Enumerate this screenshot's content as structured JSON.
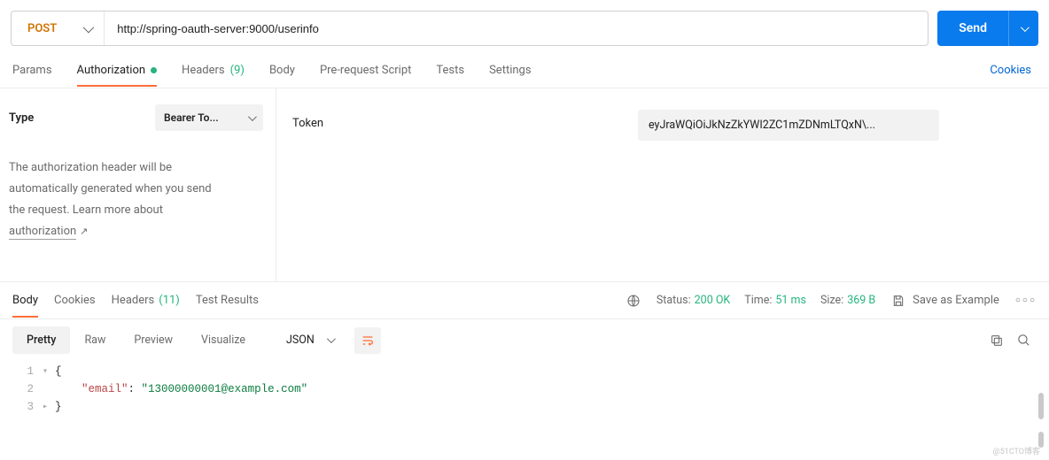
{
  "request": {
    "method": "POST",
    "url": "http://spring-oauth-server:9000/userinfo",
    "send_label": "Send"
  },
  "request_tabs": {
    "params": "Params",
    "authorization": "Authorization",
    "headers": "Headers",
    "headers_count": "(9)",
    "body": "Body",
    "prerequest": "Pre-request Script",
    "tests": "Tests",
    "settings": "Settings",
    "cookies": "Cookies"
  },
  "auth": {
    "type_label": "Type",
    "type_value": "Bearer To...",
    "desc_1": "The authorization header will be",
    "desc_2": "automatically generated when you send",
    "desc_3": "the request. Learn more about",
    "link_text": "authorization",
    "ext_glyph": "↗",
    "token_label": "Token",
    "token_value": "eyJraWQiOiJkNzZkYWI2ZC1mZDNmLTQxN\\..."
  },
  "response_tabs": {
    "body": "Body",
    "cookies": "Cookies",
    "headers": "Headers",
    "headers_count": "(11)",
    "test_results": "Test Results"
  },
  "response_meta": {
    "status_label": "Status:",
    "status_value": "200 OK",
    "time_label": "Time:",
    "time_value": "51 ms",
    "size_label": "Size:",
    "size_value": "369 B",
    "save_example": "Save as Example"
  },
  "response_toolbar": {
    "pretty": "Pretty",
    "raw": "Raw",
    "preview": "Preview",
    "visualize": "Visualize",
    "lang": "JSON"
  },
  "response_body": {
    "lines": [
      "1",
      "2",
      "3"
    ],
    "open_brace": "{",
    "close_brace": "}",
    "key": "\"email\"",
    "colon": ": ",
    "value": "\"13000000001@example.com\""
  },
  "watermark": "@51CTO博客"
}
